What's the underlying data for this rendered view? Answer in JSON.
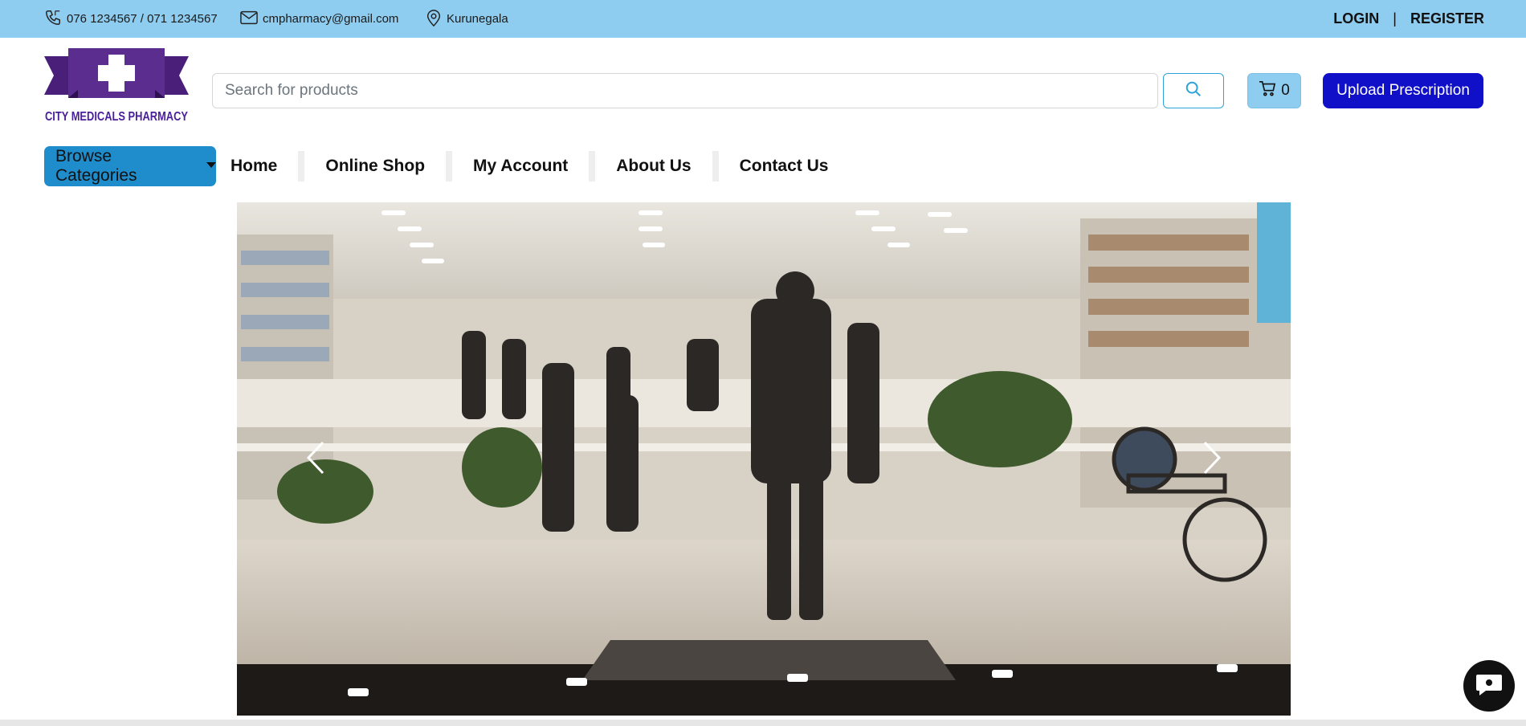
{
  "topbar": {
    "phone": "076 1234567 / 071 1234567",
    "email": "cmpharmacy@gmail.com",
    "location": "Kurunegala",
    "login_label": "LOGIN",
    "separator": "|",
    "register_label": "REGISTER"
  },
  "header": {
    "logo_text": "CITY MEDICALS PHARMACY",
    "search_placeholder": "Search for products",
    "cart_count": "0",
    "upload_label": "Upload Prescription"
  },
  "nav": {
    "browse_label": "Browse Categories",
    "links": [
      "Home",
      "Online Shop",
      "My Account",
      "About Us",
      "Contact Us"
    ]
  },
  "icons": {
    "phone": "phone-icon",
    "email": "envelope-icon",
    "location": "map-pin-icon",
    "search": "search-icon",
    "cart": "cart-icon",
    "prev": "chevron-left-icon",
    "next": "chevron-right-icon",
    "chat": "chat-icon"
  },
  "colors": {
    "topbar_bg": "#8ecdf0",
    "upload_btn_bg": "#1010c8",
    "browse_btn_bg": "#1f8ccc",
    "logo_purple": "#5b2d8e"
  }
}
